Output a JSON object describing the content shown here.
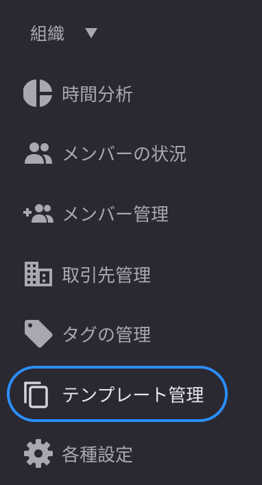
{
  "org": {
    "label": "組織"
  },
  "menu": {
    "items": [
      {
        "label": "時間分析",
        "icon": "pie-chart-icon"
      },
      {
        "label": "メンバーの状況",
        "icon": "people-icon"
      },
      {
        "label": "メンバー管理",
        "icon": "add-people-icon"
      },
      {
        "label": "取引先管理",
        "icon": "building-icon"
      },
      {
        "label": "タグの管理",
        "icon": "tag-icon"
      },
      {
        "label": "テンプレート管理",
        "icon": "copy-icon",
        "active": true
      },
      {
        "label": "各種設定",
        "icon": "gear-icon"
      }
    ]
  },
  "colors": {
    "background": "#2a2932",
    "text": "#a9a8b0",
    "active_text": "#e6e5ea",
    "focus_ring": "#2a8fff"
  }
}
